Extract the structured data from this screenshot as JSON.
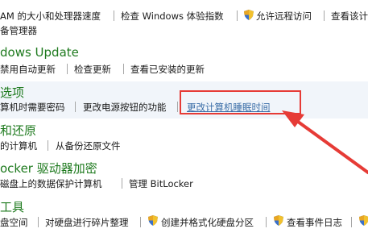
{
  "system": {
    "link_ram": "AM 的大小和处理器速度",
    "link_index": "检查 Windows 体验指数",
    "link_remote": "允许远程访问",
    "link_cut": "查看该计",
    "link_devmgr": "备管理器"
  },
  "update": {
    "heading": "dows Update",
    "link_auto": "禁用自动更新",
    "link_check": "检查更新",
    "link_installed": "查看已安装的更新"
  },
  "power": {
    "heading": "选项",
    "link_password": "算机时需要密码",
    "link_buttons": "更改电源按钮的功能",
    "link_sleep": "更改计算机睡眠时间"
  },
  "backup": {
    "heading": "和还原",
    "link_backup": "的计算机",
    "link_restore": "从备份还原文件"
  },
  "bitlocker": {
    "heading": "ocker 驱动器加密",
    "link_protect": "磁盘上的数据保护计算机",
    "link_manage": "管理 BitLocker"
  },
  "tools": {
    "heading": "工具",
    "link_space": "盘空间",
    "link_defrag": "对硬盘进行碎片整理",
    "link_partition": "创建并格式化硬盘分区",
    "link_events": "查看事件日志"
  },
  "colors": {
    "heading_green": "#1e7a1e",
    "highlight_red": "#e63b36",
    "band_bg": "#f1f5fa"
  }
}
